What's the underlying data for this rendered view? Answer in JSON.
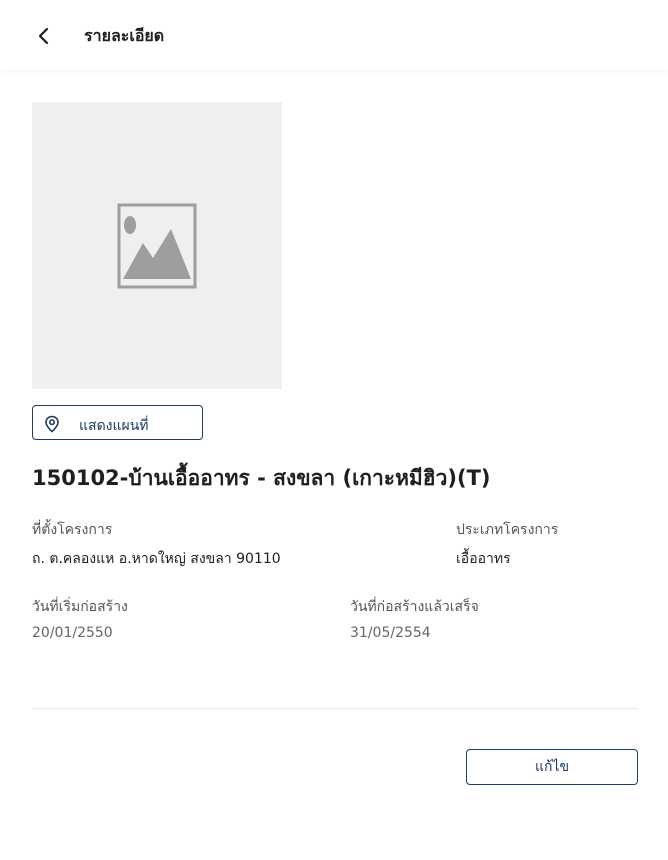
{
  "header": {
    "title": "รายละเอียด",
    "back_icon": "chevron-left-icon"
  },
  "image": {
    "icon": "image-placeholder-icon"
  },
  "map_button": {
    "icon": "map-pin-icon",
    "label": "แสดงแผนที่"
  },
  "project": {
    "title": "150102-บ้านเอื้ออาทร - สงขลา (เกาะหมีฮิว)(T)",
    "location_label": "ที่ตั้งโครงการ",
    "location_value": "ถ. ต.คลองแห อ.หาดใหญ่ สงขลา 90110",
    "type_label": "ประเภทโครงการ",
    "type_value": "เอื้ออาทร",
    "start_label": "วันที่เริ่มก่อสร้าง",
    "start_value": "20/01/2550",
    "end_label": "วันที่ก่อสร้างแล้วเสร็จ",
    "end_value": "31/05/2554"
  },
  "actions": {
    "edit_label": "แก้ไข"
  },
  "colors": {
    "accent": "#1e3a66",
    "placeholder_bg": "#eeeff1",
    "placeholder_icon": "#9e9e9e"
  }
}
